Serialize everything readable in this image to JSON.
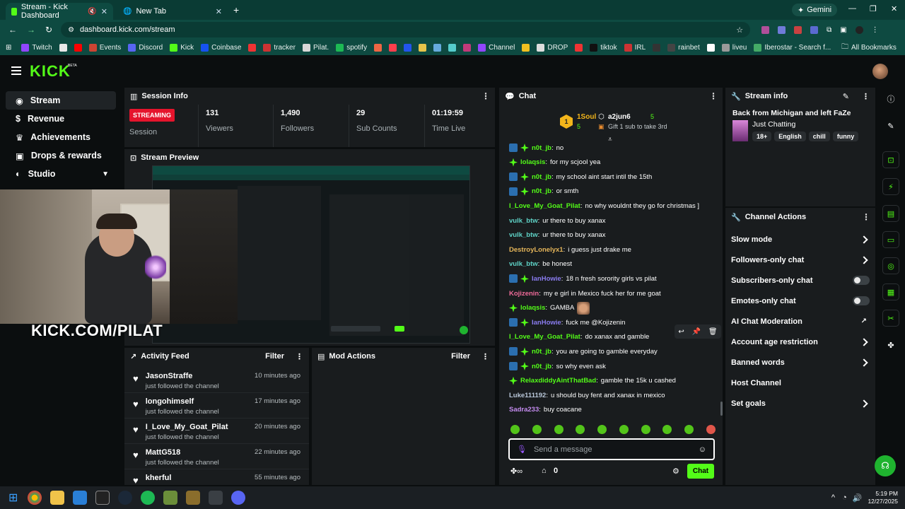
{
  "browser": {
    "tabs": [
      {
        "title": "Stream - Kick Dashboard"
      },
      {
        "title": "New Tab"
      }
    ],
    "gemini_label": "Gemini",
    "url": "dashboard.kick.com/stream",
    "bookmarks": [
      "Twitch",
      "",
      "",
      "Events",
      "Discord",
      "Kick",
      "Coinbase",
      "",
      "tracker",
      "Pilat.",
      "spotify",
      "",
      "",
      "",
      "",
      "",
      "",
      "",
      "Channel",
      "",
      "DROP",
      "",
      "tiktok",
      "IRL",
      "",
      "rainbet",
      "",
      "liveu",
      "Iberostar - Search f...",
      "All Bookmarks"
    ]
  },
  "nav": {
    "logo": "KICK",
    "logo_sup": "BETA",
    "items": [
      {
        "label": "Stream"
      },
      {
        "label": "Revenue"
      },
      {
        "label": "Achievements"
      },
      {
        "label": "Drops & rewards"
      },
      {
        "label": "Studio"
      }
    ]
  },
  "session": {
    "title": "Session Info",
    "status_badge": "STREAMING",
    "status_label": "Session",
    "stats": [
      {
        "value": "131",
        "label": "Viewers"
      },
      {
        "value": "1,490",
        "label": "Followers"
      },
      {
        "value": "29",
        "label": "Sub Counts"
      },
      {
        "value": "01:19:59",
        "label": "Time Live"
      }
    ]
  },
  "preview": {
    "title": "Stream Preview",
    "overlay_text": "KICK.COM/PILAT"
  },
  "activity": {
    "title": "Activity Feed",
    "filter_label": "Filter",
    "items": [
      {
        "name": "JasonStraffe",
        "action": "just followed the channel",
        "time": "10 minutes ago"
      },
      {
        "name": "longohimself",
        "action": "just followed the channel",
        "time": "17 minutes ago"
      },
      {
        "name": "I_Love_My_Goat_Pilat",
        "action": "just followed the channel",
        "time": "20 minutes ago"
      },
      {
        "name": "MattG518",
        "action": "just followed the channel",
        "time": "22 minutes ago"
      },
      {
        "name": "kherful",
        "action": "",
        "time": "55 minutes ago"
      }
    ]
  },
  "mod": {
    "title": "Mod Actions",
    "filter_label": "Filter"
  },
  "chat": {
    "title": "Chat",
    "leader": {
      "name": "1Soul",
      "count": "5"
    },
    "second": {
      "name": "a2jun6",
      "count": "5"
    },
    "gift_text": "Gift 1 sub to take 3rd",
    "rank": "1",
    "messages": [
      {
        "user": "n0t_jb",
        "text": "no",
        "color": "#53fc18",
        "badges": 2
      },
      {
        "user": "lolaqsis",
        "text": "for my scjool yea",
        "color": "#53fc18",
        "badges": 1
      },
      {
        "user": "n0t_jb",
        "text": "my school aint start intil the 15th",
        "color": "#53fc18",
        "badges": 2
      },
      {
        "user": "n0t_jb",
        "text": "or smth",
        "color": "#53fc18",
        "badges": 2
      },
      {
        "user": "I_Love_My_Goat_Pilat",
        "text": "no why wouldnt they go for christmas ]",
        "color": "#53fc18",
        "badges": 0
      },
      {
        "user": "vulk_btw",
        "text": "ur there to buy xanax",
        "color": "#5fd3c7",
        "badges": 0
      },
      {
        "user": "vulk_btw",
        "text": "ur there to buy xanax",
        "color": "#5fd3c7",
        "badges": 0
      },
      {
        "user": "DestroyLonelyx1",
        "text": "i guess just drake me",
        "color": "#e6b65a",
        "badges": 0
      },
      {
        "user": "vulk_btw",
        "text": "be honest",
        "color": "#5fd3c7",
        "badges": 0
      },
      {
        "user": "IanHowie",
        "text": "18 n fresh sorority girls vs pilat",
        "color": "#8a7cf0",
        "badges": 2
      },
      {
        "user": "Kojizenin",
        "text": "my e girl in Mexico fuck her for me goat",
        "color": "#f06b9a",
        "badges": 0
      },
      {
        "user": "lolaqsis",
        "text": "GAMBA",
        "color": "#53fc18",
        "badges": 1
      },
      {
        "user": "IanHowie",
        "text": "fuck me @Kojizenin",
        "color": "#8a7cf0",
        "badges": 2
      },
      {
        "user": "I_Love_My_Goat_Pilat",
        "text": "do xanax and gamble",
        "color": "#53fc18",
        "badges": 0
      },
      {
        "user": "n0t_jb",
        "text": "you are going to gamble everyday",
        "color": "#53fc18",
        "badges": 2
      },
      {
        "user": "n0t_jb",
        "text": "so why even ask",
        "color": "#53fc18",
        "badges": 2
      },
      {
        "user": "RelaxdiddyAintThatBad",
        "text": "gamble the 15k u cashed",
        "color": "#53fc18",
        "badges": 1
      },
      {
        "user": "Luke111192",
        "text": "u should buy fent and xanax in mexico",
        "color": "#b9c7d9",
        "badges": 0
      },
      {
        "user": "Sadra233",
        "text": "buy coacane",
        "color": "#c58cf0",
        "badges": 0
      }
    ],
    "input_placeholder": "Send a message",
    "points": "0",
    "send_label": "Chat"
  },
  "stream_info": {
    "title": "Stream info",
    "stream_title": "Back from Michigan and left FaZe",
    "category": "Just Chatting",
    "tags": [
      "18+",
      "English",
      "chill",
      "funny"
    ]
  },
  "channel_actions": {
    "title": "Channel Actions",
    "items": [
      {
        "label": "Slow mode",
        "control": "chevron"
      },
      {
        "label": "Followers-only chat",
        "control": "chevron"
      },
      {
        "label": "Subscribers-only chat",
        "control": "toggle"
      },
      {
        "label": "Emotes-only chat",
        "control": "toggle"
      },
      {
        "label": "AI Chat Moderation",
        "control": "external"
      },
      {
        "label": "Account age restriction",
        "control": "chevron"
      },
      {
        "label": "Banned words",
        "control": "chevron"
      },
      {
        "label": "Host Channel",
        "control": "none"
      },
      {
        "label": "Set goals",
        "control": "chevron"
      }
    ]
  },
  "taskbar": {
    "time": "5:19 PM",
    "date": "12/27/2025"
  },
  "colors": {
    "accent": "#53fc18",
    "streaming_badge": "#e5142c",
    "panel": "#191c1e"
  }
}
